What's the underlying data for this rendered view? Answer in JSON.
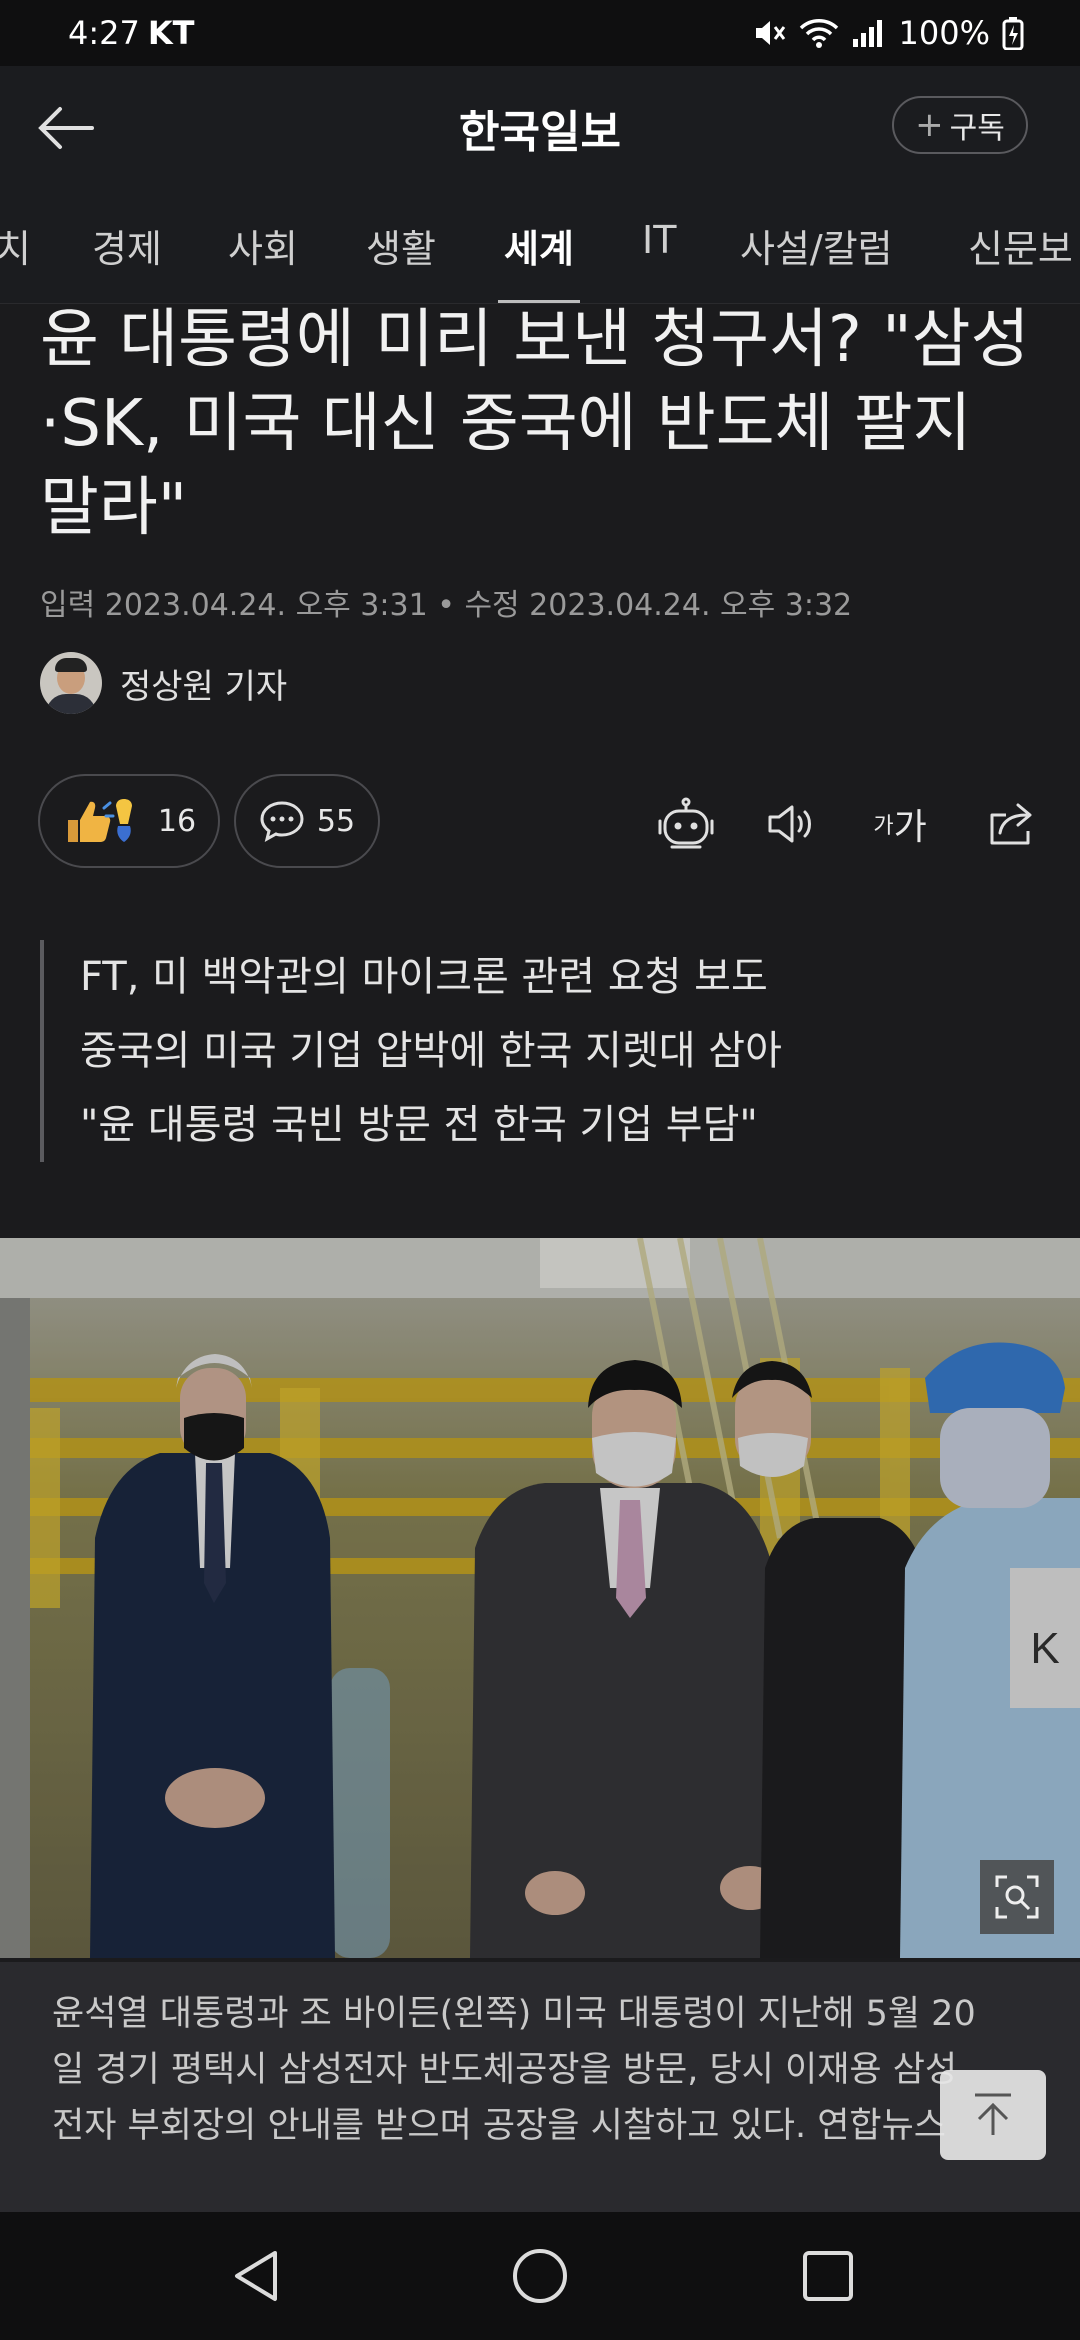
{
  "status_bar": {
    "time": "4:27",
    "carrier": "KT",
    "battery": "100%"
  },
  "app_bar": {
    "title": "한국일보",
    "subscribe_label": "구독",
    "subscribe_plus": "+"
  },
  "tabs": [
    {
      "label": "치",
      "active": false
    },
    {
      "label": "경제",
      "active": false
    },
    {
      "label": "사회",
      "active": false
    },
    {
      "label": "생활",
      "active": false
    },
    {
      "label": "세계",
      "active": true
    },
    {
      "label": "IT",
      "active": false
    },
    {
      "label": "사설/칼럼",
      "active": false
    },
    {
      "label": "신문보",
      "active": false
    }
  ],
  "article": {
    "headline": "윤 대통령에 미리 보낸 청구서? \"삼성·SK, 미국 대신 중국에 반도체 팔지 말라\"",
    "dates": "입력 2023.04.24. 오후 3:31 • 수정 2023.04.24. 오후 3:32",
    "reporter": "정상원 기자",
    "reaction_count": "16",
    "comment_count": "55",
    "font_size_label_small": "가",
    "font_size_label_large": "가",
    "summary": [
      "FT, 미 백악관의 마이크론 관련 요청 보도",
      "중국의 미국 기업 압박에 한국 지렛대 삼아",
      "\"윤 대통령 국빈 방문 전 한국 기업 부담\""
    ],
    "photo_vest_text": "K",
    "caption": [
      "윤석열 대통령과 조 바이든(왼쪽) 미국 대통령이 지난해 5월 20",
      "일 경기 평택시 삼성전자 반도체공장을 방문, 당시 이재용 삼성",
      "전자 부회장의 안내를 받으며 공장을 시찰하고 있다. 연합뉴스"
    ]
  },
  "icons": {
    "back": "back-arrow-icon",
    "reaction": "thumbs-up-icon",
    "comment": "comment-bubble-icon",
    "ai": "robot-icon",
    "speaker": "speaker-icon",
    "share": "share-icon",
    "zoom": "image-zoom-icon",
    "top": "scroll-top-icon"
  },
  "colors": {
    "background": "#1b1b1d",
    "caption_bg": "#2a2a2e",
    "text": "#e8e8e8"
  }
}
